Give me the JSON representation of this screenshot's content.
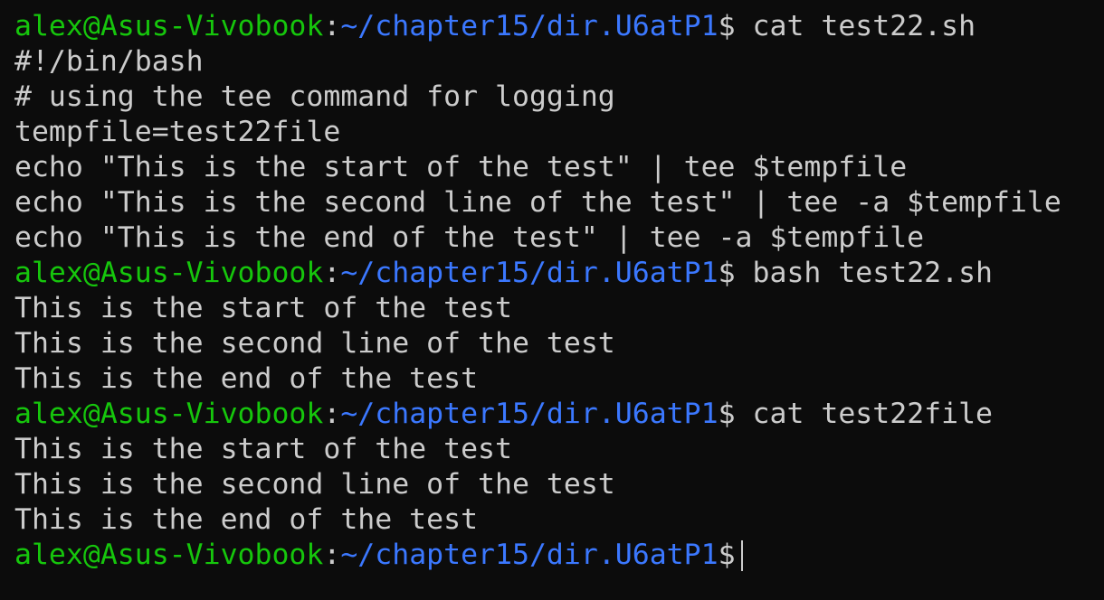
{
  "prompt": {
    "user_host": "alex@Asus-Vivobook",
    "separator": ":",
    "path": "~/chapter15/dir.U6atP1",
    "symbol": "$"
  },
  "colors": {
    "background": "#0c0c0c",
    "foreground": "#cccccc",
    "user_host": "#16c60c",
    "path": "#3b78ff"
  },
  "lines": [
    {
      "type": "prompt",
      "command": "cat test22.sh"
    },
    {
      "type": "output",
      "text": "#!/bin/bash"
    },
    {
      "type": "output",
      "text": "# using the tee command for logging"
    },
    {
      "type": "output",
      "text": "tempfile=test22file"
    },
    {
      "type": "output",
      "text": "echo \"This is the start of the test\" | tee $tempfile"
    },
    {
      "type": "output",
      "text": "echo \"This is the second line of the test\" | tee -a $tempfile"
    },
    {
      "type": "output",
      "text": "echo \"This is the end of the test\" | tee -a $tempfile"
    },
    {
      "type": "prompt",
      "command": "bash test22.sh"
    },
    {
      "type": "output",
      "text": "This is the start of the test"
    },
    {
      "type": "output",
      "text": "This is the second line of the test"
    },
    {
      "type": "output",
      "text": "This is the end of the test"
    },
    {
      "type": "prompt",
      "command": "cat test22file"
    },
    {
      "type": "output",
      "text": "This is the start of the test"
    },
    {
      "type": "output",
      "text": "This is the second line of the test"
    },
    {
      "type": "output",
      "text": "This is the end of the test"
    },
    {
      "type": "prompt",
      "command": ""
    }
  ]
}
